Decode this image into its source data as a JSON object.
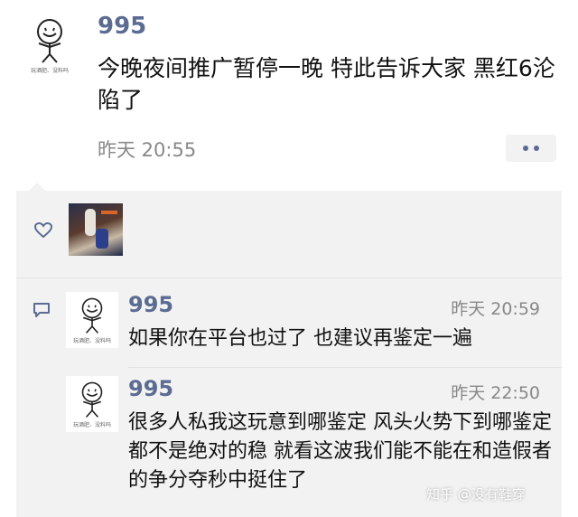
{
  "post": {
    "username": "995",
    "avatar_caption": "玩酒肥、没料吗",
    "text": "今晚夜间推广暂停一晚 特此告诉大家 黑红6沦陷了",
    "timestamp": "昨天 20:55",
    "more_icon": "more-dots-icon"
  },
  "likes": {
    "icon": "heart-icon"
  },
  "comments": [
    {
      "username": "995",
      "avatar_caption": "玩酒肥、没料吗",
      "timestamp": "昨天 20:59",
      "text": "如果你在平台也过了 也建议再鉴定一遍"
    },
    {
      "username": "995",
      "avatar_caption": "玩酒肥、没料吗",
      "timestamp": "昨天 22:50",
      "text": "很多人私我这玩意到哪鉴定 风头火势下到哪鉴定都不是绝对的稳 就看这波我们能不能在和造假者的争分夺秒中挺住了"
    }
  ],
  "comment_icon": "comment-icon",
  "watermark": "知乎 @没有鞋穿",
  "colors": {
    "username": "#5b6b92",
    "panel_bg": "#f2f2f2",
    "time": "#888888"
  }
}
